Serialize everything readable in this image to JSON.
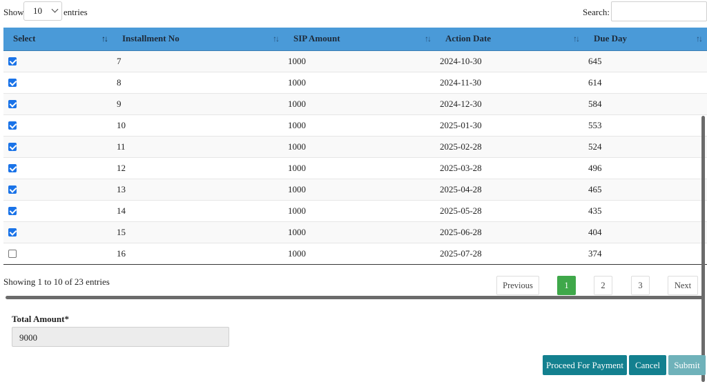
{
  "controls": {
    "show_label": "Show",
    "page_length": "10",
    "entries_label": "entries",
    "search_label": "Search:",
    "search_value": ""
  },
  "table": {
    "columns": [
      "Select",
      "Installment No",
      "SIP Amount",
      "Action Date",
      "Due Day"
    ],
    "sort_icon": "↑↓",
    "rows": [
      {
        "checked": true,
        "installment": "7",
        "amount": "1000",
        "date": "2024-10-30",
        "due": "645"
      },
      {
        "checked": true,
        "installment": "8",
        "amount": "1000",
        "date": "2024-11-30",
        "due": "614"
      },
      {
        "checked": true,
        "installment": "9",
        "amount": "1000",
        "date": "2024-12-30",
        "due": "584"
      },
      {
        "checked": true,
        "installment": "10",
        "amount": "1000",
        "date": "2025-01-30",
        "due": "553"
      },
      {
        "checked": true,
        "installment": "11",
        "amount": "1000",
        "date": "2025-02-28",
        "due": "524"
      },
      {
        "checked": true,
        "installment": "12",
        "amount": "1000",
        "date": "2025-03-28",
        "due": "496"
      },
      {
        "checked": true,
        "installment": "13",
        "amount": "1000",
        "date": "2025-04-28",
        "due": "465"
      },
      {
        "checked": true,
        "installment": "14",
        "amount": "1000",
        "date": "2025-05-28",
        "due": "435"
      },
      {
        "checked": true,
        "installment": "15",
        "amount": "1000",
        "date": "2025-06-28",
        "due": "404"
      },
      {
        "checked": false,
        "installment": "16",
        "amount": "1000",
        "date": "2025-07-28",
        "due": "374"
      }
    ]
  },
  "info_text": "Showing 1 to 10 of 23 entries",
  "pagination": {
    "previous": "Previous",
    "pages": [
      "1",
      "2",
      "3"
    ],
    "current": "1",
    "next": "Next"
  },
  "form": {
    "total_label": "Total Amount*",
    "total_value": "9000"
  },
  "buttons": {
    "proceed": "Proceed For Payment",
    "cancel": "Cancel",
    "submit": "Submit"
  },
  "colors": {
    "header": "#4a9ad8",
    "checkbox": "#1a73e8",
    "current_page": "#3fa84a",
    "primary_button": "#13808f",
    "disabled_button": "#6fb2ba"
  }
}
